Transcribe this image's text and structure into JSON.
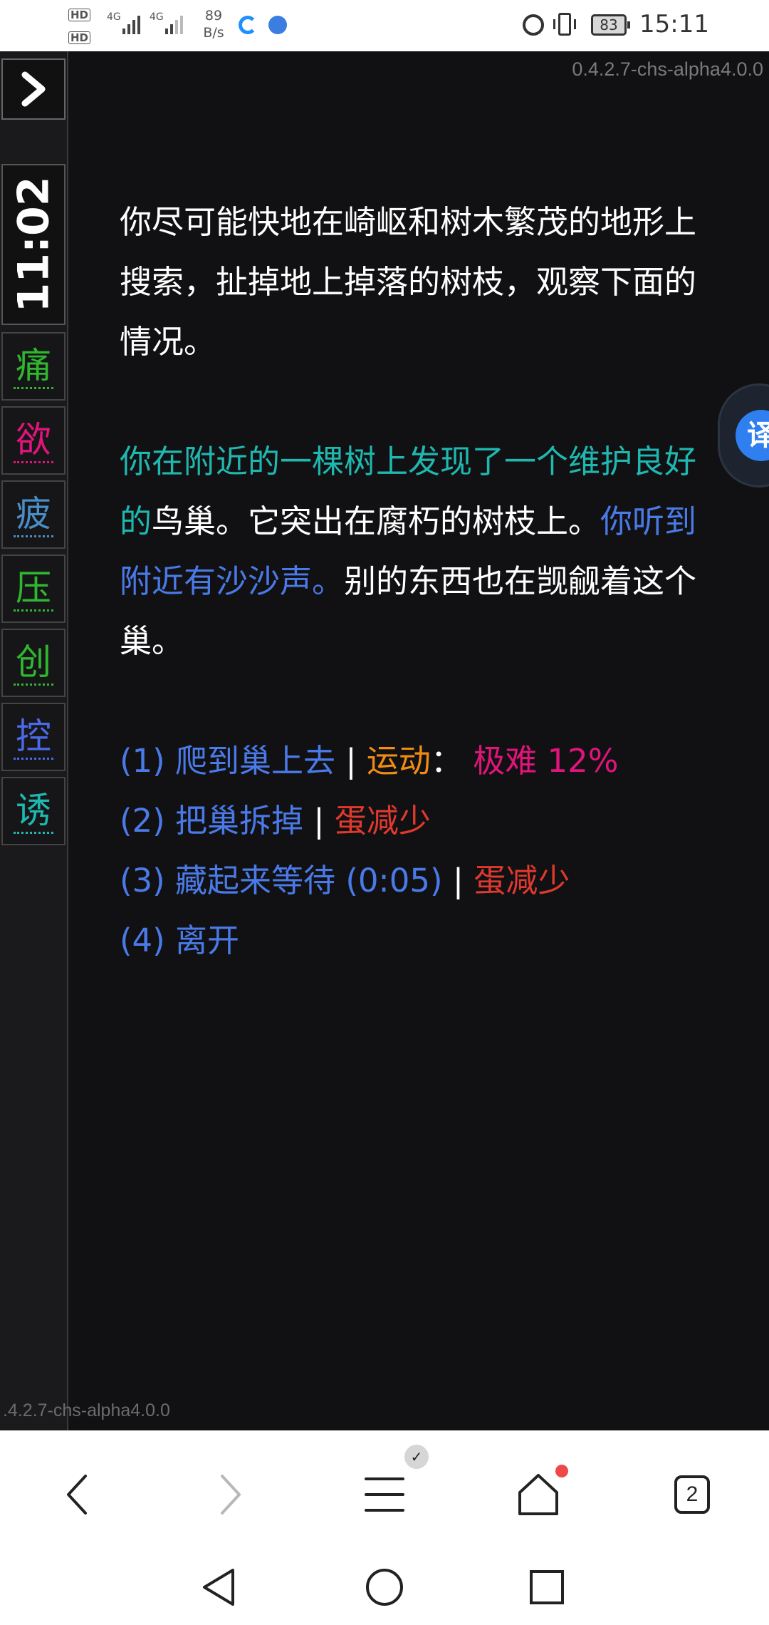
{
  "status_bar": {
    "hd1": "HD",
    "hd2": "HD",
    "net1": "4G",
    "net2": "4G",
    "speed_value": "89",
    "speed_unit": "B/s",
    "battery": "83",
    "time": "15:11"
  },
  "sidebar": {
    "toggle_icon": "chevron-right-icon",
    "clock": "11:02",
    "stats": [
      {
        "label": "痛",
        "color": "#2fb82f"
      },
      {
        "label": "欲",
        "color": "#e0147a"
      },
      {
        "label": "疲",
        "color": "#4a8ec8"
      },
      {
        "label": "压",
        "color": "#2fb82f"
      },
      {
        "label": "创",
        "color": "#2fb82f"
      },
      {
        "label": "控",
        "color": "#4a6ae8"
      },
      {
        "label": "诱",
        "color": "#1fb8b0"
      }
    ]
  },
  "version_top": "0.4.2.7-chs-alpha4.0.0",
  "version_bottom": ".4.2.7-chs-alpha4.0.0",
  "story": {
    "para1": "你尽可能快地在崎岖和树木繁茂的地形上搜索，扯掉地上掉落的树枝，观察下面的情况。",
    "para2_teal": "你在附近的一棵树上发现了一个维护良好的",
    "para2_white": "鸟巢。它突出在腐朽的树枝上。",
    "para2_blue": "你听到附近有沙沙声。",
    "para2_white2": "别的东西也在觊觎着这个巢。"
  },
  "choices": [
    {
      "text": "(1) 爬到巢上去",
      "sep": " | ",
      "tag": "运动",
      "colon": "：",
      "extra": "极难 12%"
    },
    {
      "text": "(2) 把巢拆掉",
      "sep": " | ",
      "tag": "蛋减少"
    },
    {
      "text": "(3) 藏起来等待 (0:05)",
      "sep": " | ",
      "tag": "蛋减少"
    },
    {
      "text": "(4) 离开"
    }
  ],
  "float_button": {
    "label": "译"
  },
  "browser_bar": {
    "tab_count": "2",
    "badge": "✓",
    "icons": [
      "back-icon",
      "forward-icon",
      "menu-icon",
      "home-icon",
      "tabs-icon"
    ]
  },
  "nav_bar": {
    "icons": [
      "nav-back-icon",
      "nav-home-icon",
      "nav-recents-icon"
    ]
  },
  "colors": {
    "background": "#111113",
    "teal": "#1fb8b0",
    "blue": "#4a7ae8",
    "orange": "#f08c14",
    "magenta": "#e0147a",
    "red": "#e0392e"
  }
}
